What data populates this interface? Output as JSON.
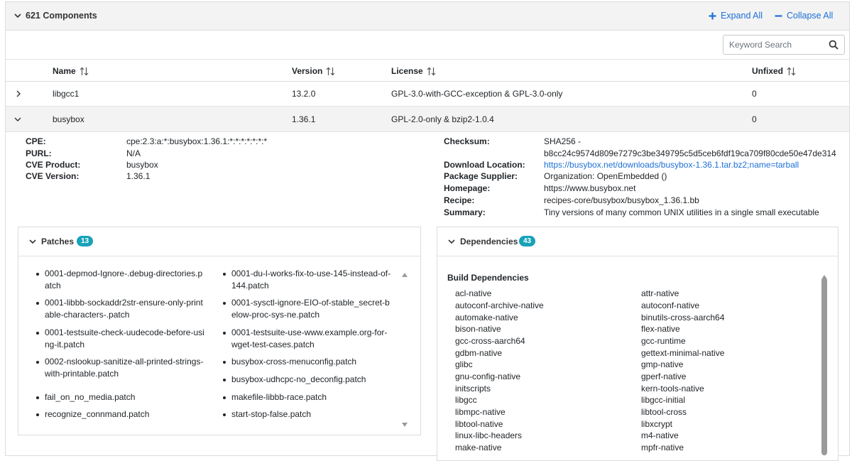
{
  "header": {
    "components_count_label": "621 Components",
    "expand_all": "Expand All",
    "collapse_all": "Collapse All"
  },
  "search": {
    "placeholder": "Keyword Search",
    "value": ""
  },
  "table": {
    "columns": [
      "Name",
      "Version",
      "License",
      "Unfixed"
    ],
    "rows": [
      {
        "name": "libgcc1",
        "version": "13.2.0",
        "license": "GPL-3.0-with-GCC-exception & GPL-3.0-only",
        "unfixed": "0",
        "expanded": false
      },
      {
        "name": "busybox",
        "version": "1.36.1",
        "license": "GPL-2.0-only & bzip2-1.0.4",
        "unfixed": "0",
        "expanded": true
      }
    ]
  },
  "details": {
    "left": [
      {
        "label": "CPE:",
        "value": "cpe:2.3:a:*:busybox:1.36.1:*:*:*:*:*:*:*"
      },
      {
        "label": "PURL:",
        "value": "N/A"
      },
      {
        "label": "CVE Product:",
        "value": "busybox"
      },
      {
        "label": "CVE Version:",
        "value": "1.36.1"
      }
    ],
    "right": {
      "checksum_label": "Checksum:",
      "checksum_line1": "SHA256 -",
      "checksum_line2": "b8cc24c9574d809e7279c3be349795c5d5ceb6fdf19ca709f80cde50e47de314",
      "download_label": "Download Location:",
      "download_value": "https://busybox.net/downloads/busybox-1.36.1.tar.bz2;name=tarball",
      "supplier_label": "Package Supplier:",
      "supplier_value": "Organization: OpenEmbedded ()",
      "homepage_label": "Homepage:",
      "homepage_value": "https://www.busybox.net",
      "recipe_label": "Recipe:",
      "recipe_value": "recipes-core/busybox/busybox_1.36.1.bb",
      "summary_label": "Summary:",
      "summary_value": "Tiny versions of many common UNIX utilities in a single small executable"
    }
  },
  "patches": {
    "title": "Patches",
    "count": "13",
    "left": [
      "0001-depmod-Ignore-.debug-directories.patch",
      "0001-libbb-sockaddr2str-ensure-only-printable-characters-.patch",
      "0001-testsuite-check-uudecode-before-using-it.patch",
      "0002-nslookup-sanitize-all-printed-strings-with-printable.patch",
      "fail_on_no_media.patch",
      "recognize_connmand.patch"
    ],
    "right": [
      "0001-du-l-works-fix-to-use-145-instead-of-144.patch",
      "0001-sysctl-ignore-EIO-of-stable_secret-below-proc-sys-ne.patch",
      "0001-testsuite-use-www.example.org-for-wget-test-cases.patch",
      "busybox-cross-menuconfig.patch",
      "busybox-udhcpc-no_deconfig.patch",
      "makefile-libbb-race.patch",
      "start-stop-false.patch"
    ]
  },
  "dependencies": {
    "title": "Dependencies",
    "count": "43",
    "build_title": "Build Dependencies",
    "left": [
      "acl-native",
      "autoconf-archive-native",
      "automake-native",
      "bison-native",
      "gcc-cross-aarch64",
      "gdbm-native",
      "glibc",
      "gnu-config-native",
      "initscripts",
      "libgcc",
      "libmpc-native",
      "libtool-native",
      "linux-libc-headers",
      "make-native"
    ],
    "right": [
      "attr-native",
      "autoconf-native",
      "binutils-cross-aarch64",
      "flex-native",
      "gcc-runtime",
      "gettext-minimal-native",
      "gmp-native",
      "gperf-native",
      "kern-tools-native",
      "libgcc-initial",
      "libtool-cross",
      "libxcrypt",
      "m4-native",
      "mpfr-native"
    ]
  }
}
